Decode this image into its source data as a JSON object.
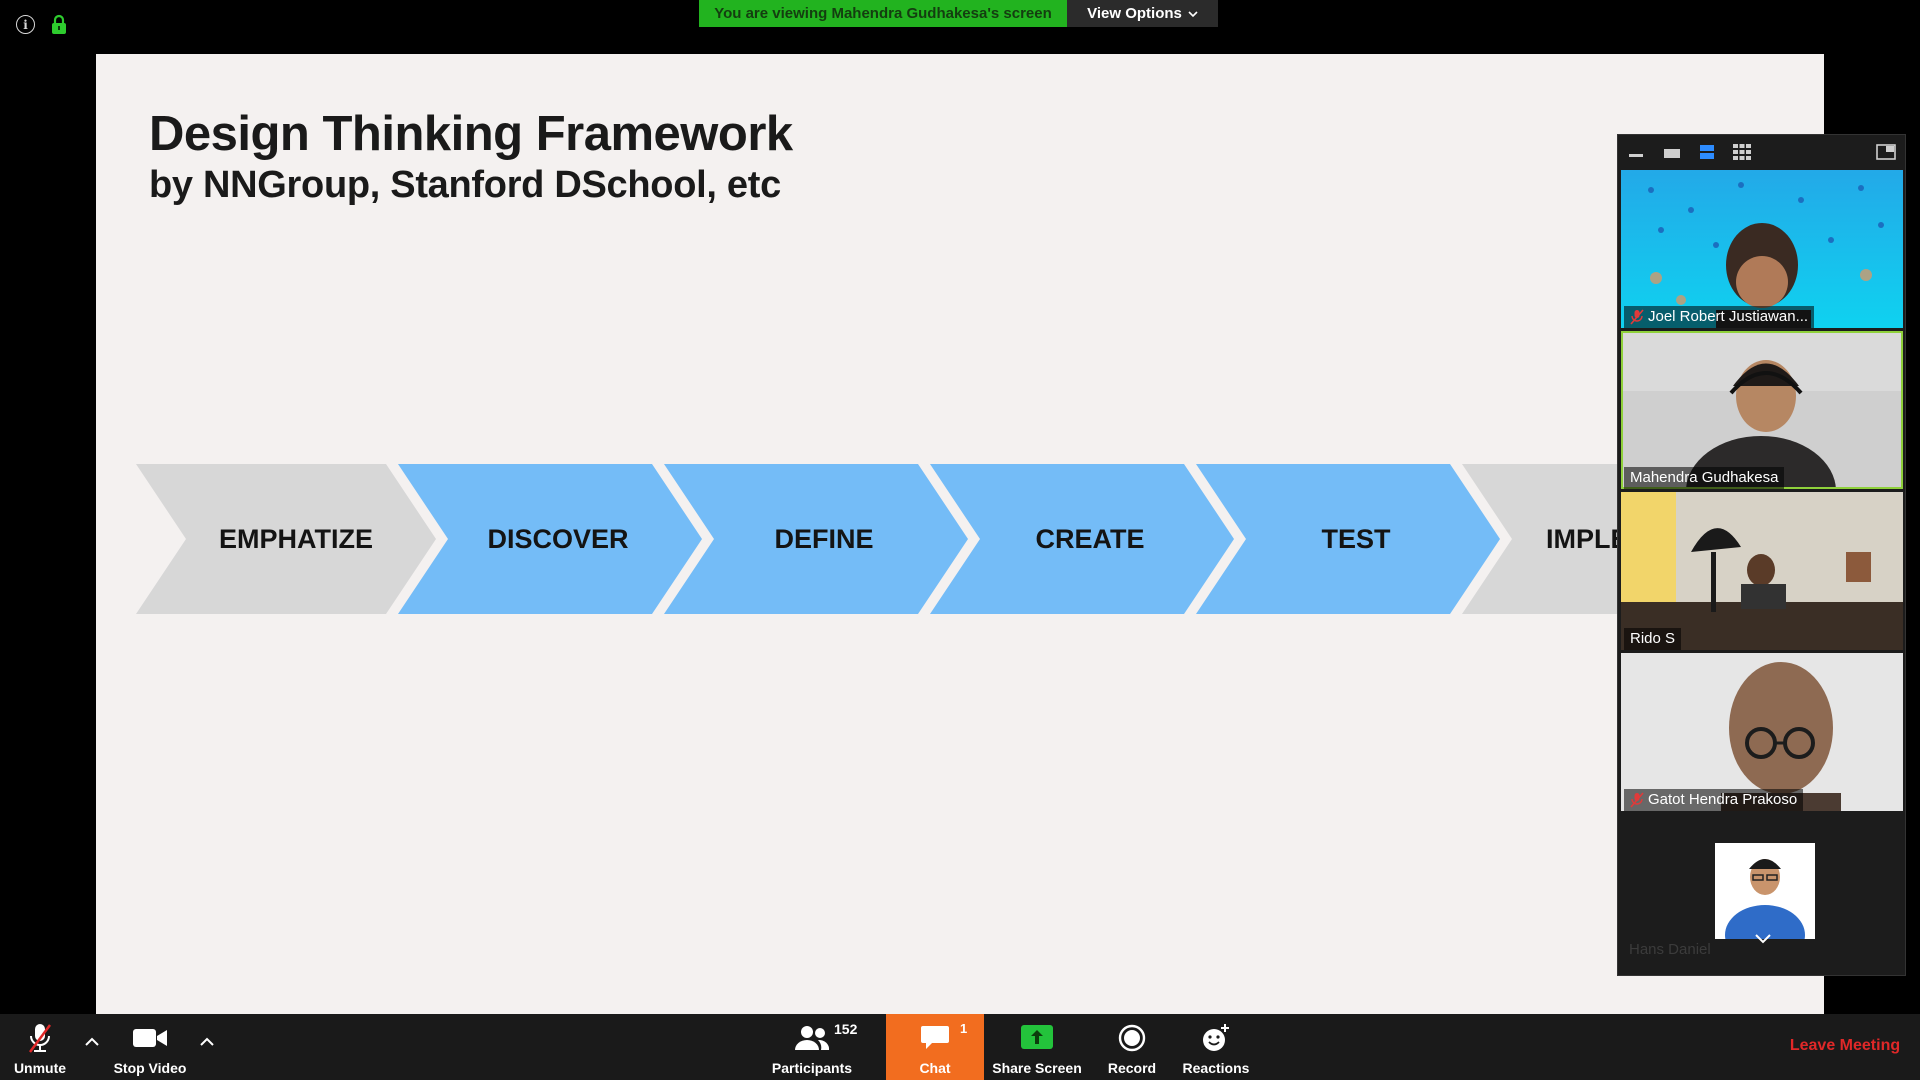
{
  "banner": {
    "viewing_text": "You are viewing Mahendra Gudhakesa's screen",
    "view_options_label": "View Options"
  },
  "slide": {
    "title": "Design Thinking Framework",
    "subtitle": "by NNGroup, Stanford DSchool, etc",
    "stages": [
      {
        "label": "EMPHATIZE",
        "color": "#d7d7d7"
      },
      {
        "label": "DISCOVER",
        "color": "#74bcf7"
      },
      {
        "label": "DEFINE",
        "color": "#74bcf7"
      },
      {
        "label": "CREATE",
        "color": "#74bcf7"
      },
      {
        "label": "TEST",
        "color": "#74bcf7"
      },
      {
        "label": "IMPLE",
        "color": "#d7d7d7"
      }
    ]
  },
  "participants_gallery": {
    "tiles": [
      {
        "name": "Joel Robert Justiawan...",
        "muted": true
      },
      {
        "name": "Mahendra Gudhakesa",
        "muted": false,
        "active_speaker": true
      },
      {
        "name": "Rido S",
        "muted": false
      },
      {
        "name": "Gatot Hendra Prakoso",
        "muted": true
      },
      {
        "name": "Hans Daniel",
        "muted": false
      }
    ]
  },
  "toolbar": {
    "unmute_label": "Unmute",
    "stop_video_label": "Stop Video",
    "participants_label": "Participants",
    "participants_count": "152",
    "chat_label": "Chat",
    "chat_badge": "1",
    "share_screen_label": "Share Screen",
    "record_label": "Record",
    "reactions_label": "Reactions",
    "leave_label": "Leave Meeting"
  },
  "colors": {
    "banner_green": "#22b31f",
    "chat_orange": "#f26d1f",
    "share_green": "#23c33b",
    "leave_red": "#e02828",
    "active_speaker_outline": "#8fd13b"
  }
}
